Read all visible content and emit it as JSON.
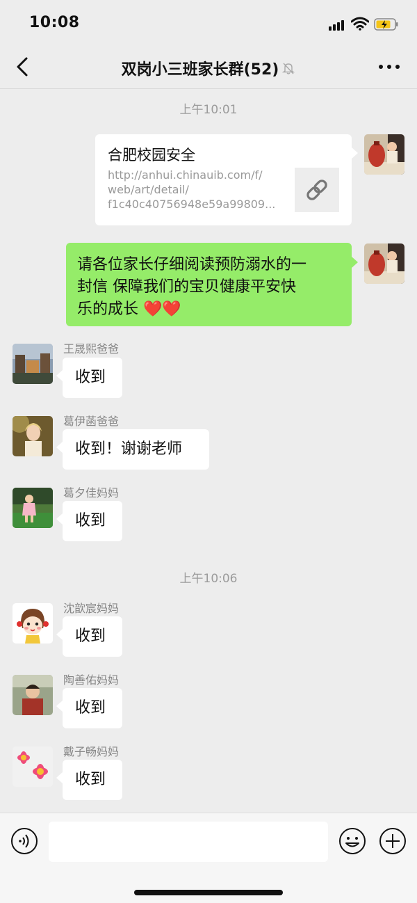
{
  "status_bar": {
    "time": "10:08"
  },
  "nav": {
    "title": "双岗小三班家长群(52)"
  },
  "timestamps": [
    "上午10:01",
    "上午10:06"
  ],
  "messages": {
    "link_card": {
      "title": "合肥校园安全",
      "url_lines": [
        "http://anhui.chinauib.com/f/",
        "web/art/detail/",
        "f1c40c40756948e59a99809..."
      ]
    },
    "notice": {
      "lines": [
        "请各位家长仔细阅读预防溺水的一",
        "封信 保障我们的宝贝健康平安快",
        "乐的成长 ❤️❤️"
      ]
    },
    "replies": [
      {
        "sender": "王晟熙爸爸",
        "text": "收到"
      },
      {
        "sender": "葛伊菡爸爸",
        "text": "收到！谢谢老师"
      },
      {
        "sender": "葛夕佳妈妈",
        "text": "收到"
      },
      {
        "sender": "沈歆宸妈妈",
        "text": "收到"
      },
      {
        "sender": "陶善佑妈妈",
        "text": "收到"
      },
      {
        "sender": "戴子畅妈妈",
        "text": "收到"
      }
    ]
  },
  "colors": {
    "background": "#ededed",
    "bubble_green": "#95ec69",
    "bubble_white": "#ffffff",
    "meta_text": "#9b9b9b"
  },
  "icons": [
    "back-chevron-icon",
    "mute-bell-icon",
    "more-dots-icon",
    "link-icon",
    "voice-icon",
    "emoji-icon",
    "plus-icon",
    "signal-icon",
    "wifi-icon",
    "battery-icon"
  ]
}
